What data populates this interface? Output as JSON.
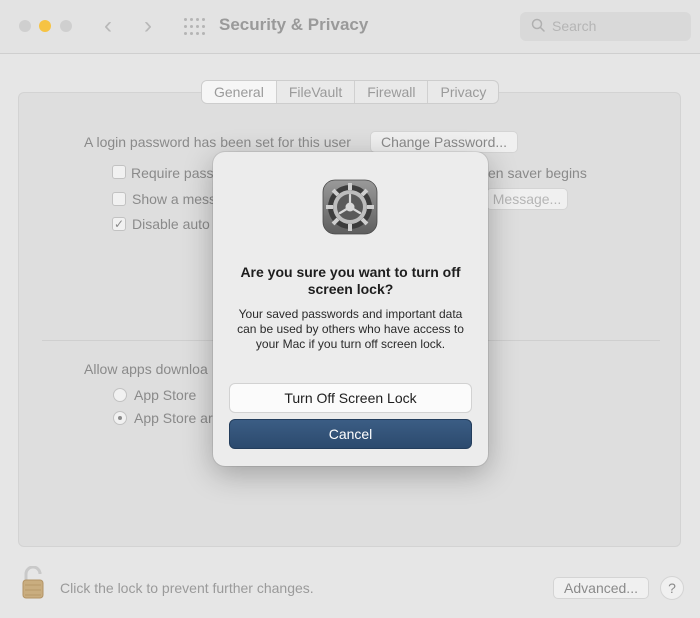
{
  "window": {
    "title": "Security & Privacy",
    "search_placeholder": "Search"
  },
  "tabs": [
    {
      "label": "General",
      "active": true
    },
    {
      "label": "FileVault",
      "active": false
    },
    {
      "label": "Firewall",
      "active": false
    },
    {
      "label": "Privacy",
      "active": false
    }
  ],
  "general": {
    "login_text": "A login password has been set for this user",
    "change_password_label": "Change Password...",
    "require_password_label": "Require pass",
    "require_password_suffix": "en saver begins",
    "show_message_label": "Show a mess",
    "set_message_label": "Message...",
    "disable_auto_label": "Disable auto",
    "disable_auto_checked": true,
    "allow_apps_label": "Allow apps downloa",
    "app_store_label": "App Store",
    "app_store_and_label": "App Store ar",
    "selected_option": "App Store ar"
  },
  "footer": {
    "lock_text": "Click the lock to prevent further changes.",
    "advanced_label": "Advanced...",
    "help_label": "?"
  },
  "dialog": {
    "title": "Are you sure you want to turn off screen lock?",
    "message": "Your saved passwords and important data can be used by others who have access to your Mac if you turn off screen lock.",
    "confirm_label": "Turn Off Screen Lock",
    "cancel_label": "Cancel",
    "icon": "system-preferences-gear-icon"
  },
  "colors": {
    "accent": "#2f4f74",
    "minimize_yellow": "#f6c343"
  }
}
